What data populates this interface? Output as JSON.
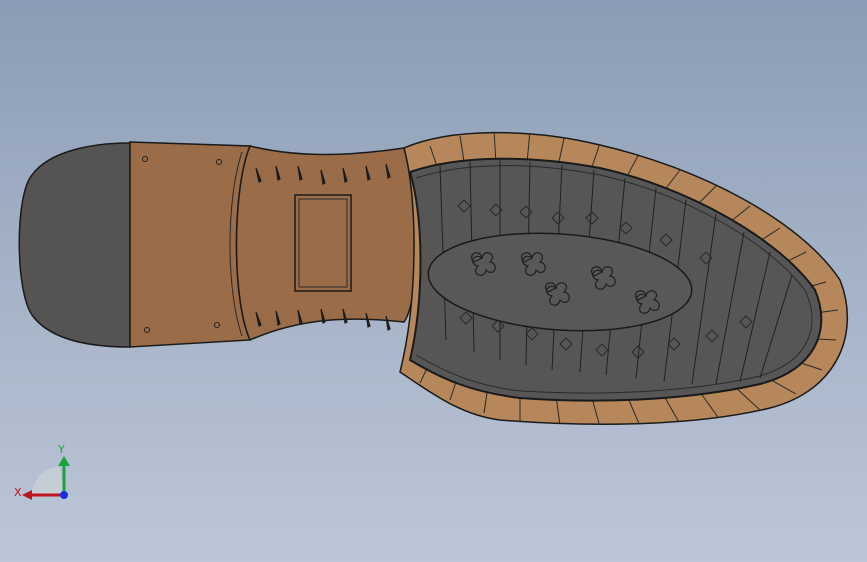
{
  "viewport": {
    "background_top": "#8a9cb5",
    "background_bottom": "#bcc6d6"
  },
  "model": {
    "heel_color": "#565453",
    "leather_color": "#9a6c47",
    "welt_color": "#b5875a",
    "rubber_color": "#555655",
    "edge_color": "#1a1a1a"
  },
  "triad": {
    "x_label": "X",
    "y_label": "Y",
    "x_color": "#c0141e",
    "y_color": "#18a53a",
    "z_color": "#1a2ee0",
    "icon": "reference-triad-icon"
  }
}
